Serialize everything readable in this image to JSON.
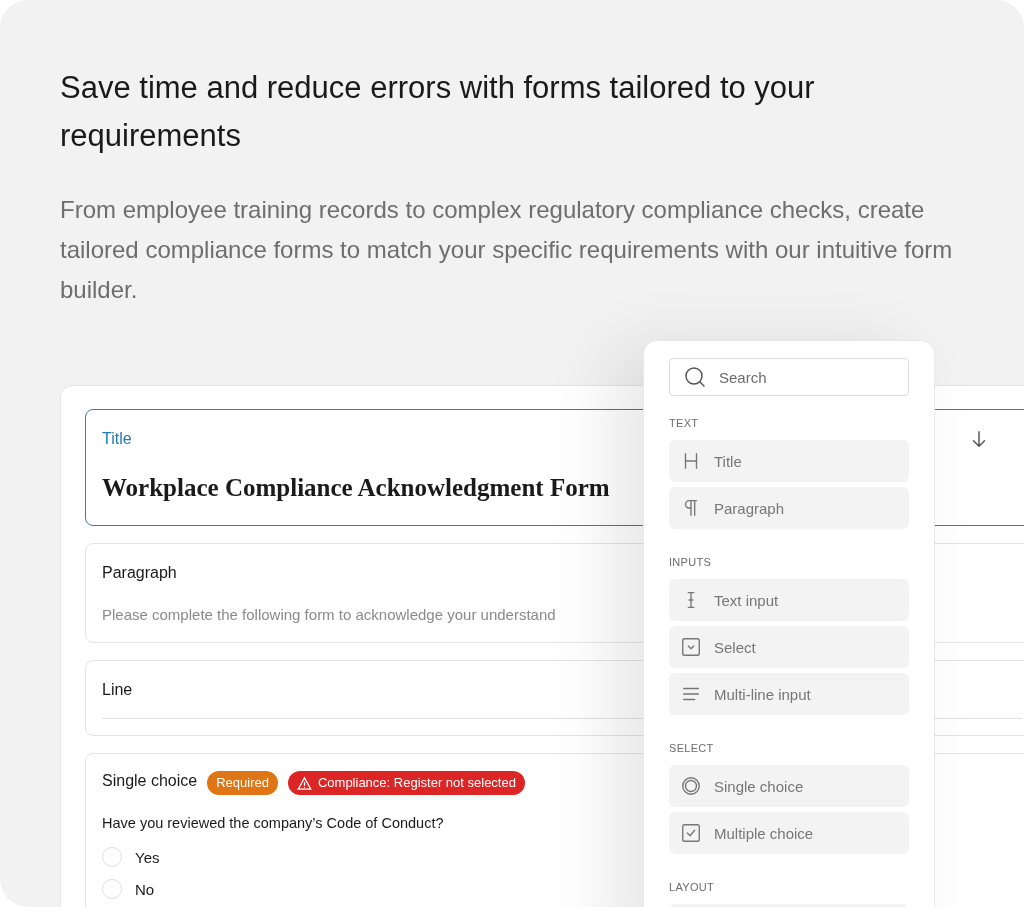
{
  "heading": "Save time and reduce errors with forms tailored to your requirements",
  "description": "From employee training records to complex regulatory compliance checks, create tailored compliance forms to match your specific requirements with our intuitive form builder.",
  "form": {
    "blocks": [
      {
        "kind": "title",
        "label": "Title",
        "value": "Workplace Compliance Acknowledgment Form",
        "selected": true
      },
      {
        "kind": "paragraph",
        "label": "Paragraph",
        "text": "Please complete the following form to acknowledge your understand",
        "selected": false
      },
      {
        "kind": "line",
        "label": "Line",
        "selected": false
      },
      {
        "kind": "single_choice",
        "label": "Single choice",
        "selected": false,
        "badges": [
          {
            "kind": "required",
            "text": "Required"
          },
          {
            "kind": "warning",
            "text": "Compliance: Register not selected"
          }
        ],
        "question": "Have you reviewed the company’s Code of Conduct?",
        "options": [
          {
            "label": "Yes",
            "selected": false
          },
          {
            "label": "No",
            "selected": false
          }
        ]
      }
    ]
  },
  "palette": {
    "search_placeholder": "Search",
    "sections": [
      {
        "title": "TEXT",
        "items": [
          {
            "kind": "heading",
            "label": "Title"
          },
          {
            "kind": "pilcrow",
            "label": "Paragraph"
          }
        ]
      },
      {
        "title": "INPUTS",
        "items": [
          {
            "kind": "cursor",
            "label": "Text input"
          },
          {
            "kind": "dropdown",
            "label": "Select"
          },
          {
            "kind": "lines",
            "label": "Multi-line input"
          }
        ]
      },
      {
        "title": "SELECT",
        "items": [
          {
            "kind": "radio",
            "label": "Single choice"
          },
          {
            "kind": "checkbox",
            "label": "Multiple choice"
          }
        ]
      },
      {
        "title": "LAYOUT",
        "items": [
          {
            "kind": "blank"
          }
        ]
      }
    ]
  }
}
